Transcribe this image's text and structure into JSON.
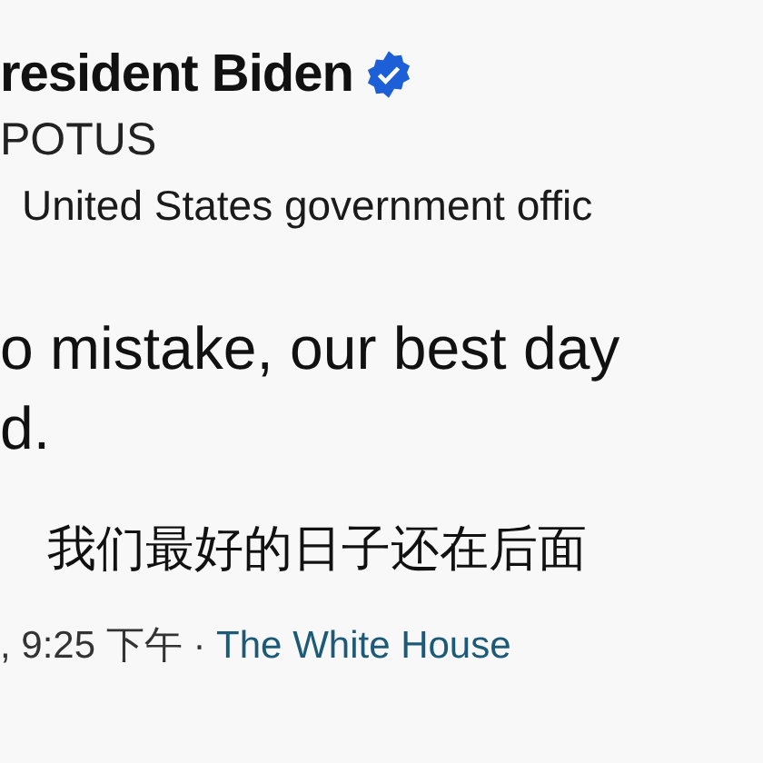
{
  "author": {
    "name": "resident Biden",
    "verified": true,
    "handle": "POTUS",
    "label": "United States government offic"
  },
  "tweet": {
    "lines": [
      "o mistake, our best day",
      "d."
    ],
    "translation": "我们最好的日子还在后面"
  },
  "meta": {
    "time": ", 9:25 下午 · ",
    "source": "The White House"
  }
}
